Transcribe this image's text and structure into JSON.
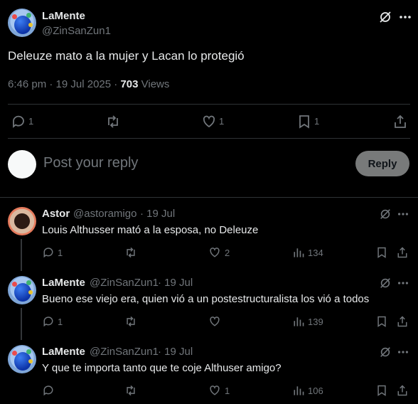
{
  "main_tweet": {
    "author_name": "LaMente",
    "author_handle": "@ZinSanZun1",
    "text": "Deleuze mato a la mujer y Lacan lo protegió",
    "timestamp": "6:46 pm · 19 Jul 2025 · ",
    "views_count": "703",
    "views_label": " Views",
    "replies": "1",
    "likes": "1",
    "bookmarks": "1"
  },
  "compose": {
    "placeholder": "Post your reply",
    "button_label": "Reply"
  },
  "replies": [
    {
      "author_name": "Astor",
      "author_handle": "@astoramigo",
      "date": "· 19 Jul",
      "text": "Louis Althusser mató a la esposa, no Deleuze",
      "replies": "1",
      "likes": "2",
      "views": "134"
    },
    {
      "author_name": "LaMente",
      "author_handle": "@ZinSanZun1",
      "date": "· 19 Jul",
      "text": "Bueno ese viejo era, quien vió a un postestructuralista los vió a todos",
      "replies": "1",
      "likes": "",
      "views": "139"
    },
    {
      "author_name": "LaMente",
      "author_handle": "@ZinSanZun1",
      "date": "· 19 Jul",
      "text": "Y que te importa tanto que te coje Althuser amigo?",
      "replies": "",
      "likes": "1",
      "views": "106"
    }
  ],
  "colors": {
    "background": "#000000",
    "text": "#e7e9ea",
    "muted": "#71767b",
    "divider": "#2f3336",
    "reply_button": "#787a7a"
  }
}
